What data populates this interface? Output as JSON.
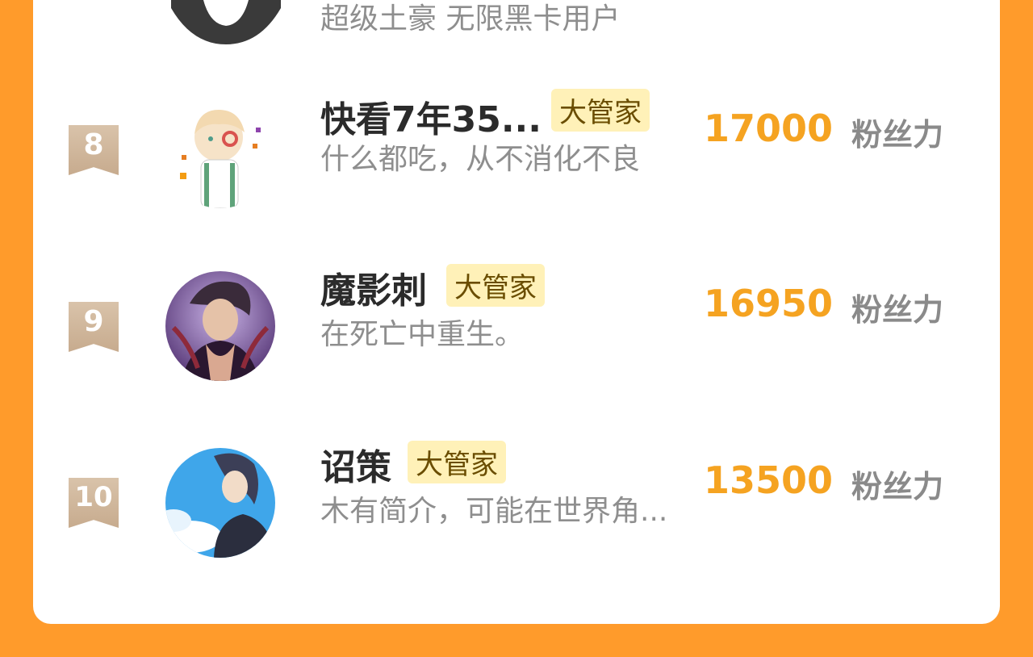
{
  "top_partial": {
    "bio": "超级土豪 无限黑卡用户"
  },
  "rows": [
    {
      "rank": "8",
      "name": "快看7年35...",
      "badge": "大管家",
      "bio": "什么都吃，从不消化不良",
      "score": "17000",
      "unit": "粉丝力",
      "avatar_icon": "anime-boy-avatar-icon"
    },
    {
      "rank": "9",
      "name": "魔影刺",
      "badge": "大管家",
      "bio": "在死亡中重生。",
      "score": "16950",
      "unit": "粉丝力",
      "avatar_icon": "dark-anime-avatar-icon"
    },
    {
      "rank": "10",
      "name": "诏策",
      "badge": "大管家",
      "bio": "木有简介，可能在世界角...",
      "score": "13500",
      "unit": "粉丝力",
      "avatar_icon": "sky-anime-avatar-icon"
    }
  ],
  "colors": {
    "background": "#FF9B2B",
    "score": "#F5A321",
    "badge_bg": "#FFF1B8",
    "ribbon": "#C7AB8E"
  }
}
